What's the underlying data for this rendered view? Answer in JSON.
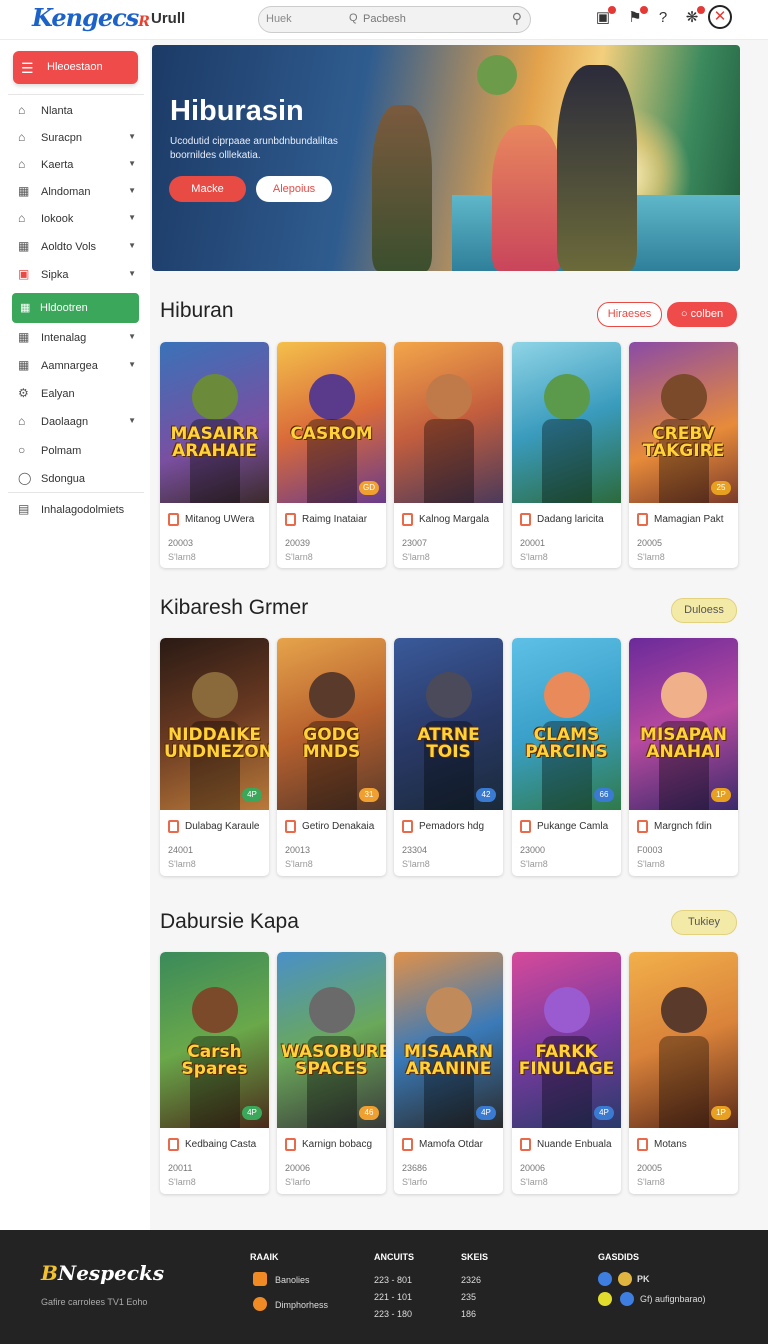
{
  "topbar": {
    "logo_main": "Kengecs",
    "logo_accent": "R",
    "user": "Urull",
    "search_placeholder": "Huek",
    "search_hint": "Pacbesh",
    "search_hint_icon": "Q"
  },
  "sidebar": {
    "primary_label": "Hleoestaon",
    "items": [
      {
        "label": "Nlanta",
        "icon": "home-icon",
        "chev": false
      },
      {
        "label": "Suracpn",
        "icon": "home-icon",
        "chev": true
      },
      {
        "label": "Kaerta",
        "icon": "home-icon",
        "chev": true
      },
      {
        "label": "Alndoman",
        "icon": "grid-icon",
        "chev": true
      },
      {
        "label": "Iokook",
        "icon": "home-icon",
        "chev": true
      },
      {
        "label": "Aoldto Vols",
        "icon": "grid-icon",
        "chev": true
      },
      {
        "label": "Sipka",
        "icon": "box-icon",
        "chev": true
      }
    ],
    "active_label": "Hldootren",
    "items2": [
      {
        "label": "Intenalag",
        "icon": "grid-icon",
        "chev": true
      },
      {
        "label": "Aamnargea",
        "icon": "grid-icon",
        "chev": true
      },
      {
        "label": "Ealyan",
        "icon": "gear-icon",
        "chev": false
      },
      {
        "label": "Daolaagn",
        "icon": "home-icon",
        "chev": true
      },
      {
        "label": "Polmam",
        "icon": "circle-icon",
        "chev": false
      },
      {
        "label": "Sdongua",
        "icon": "shield-icon",
        "chev": false
      }
    ],
    "bottom_label": "Inhalagodolmiets"
  },
  "hero": {
    "title": "Hiburasin",
    "desc": "Ucodutid ciprpaae arunbdnbundaliltas boornildes olllekatia.",
    "btn1": "Macke",
    "btn2": "Alepoius"
  },
  "sections": [
    {
      "title": "Hiburan",
      "pill1": "Hiraeses",
      "pill2": "colben",
      "pill2_icon": "○",
      "cards": [
        {
          "art": "MASAIRR ARAHAIE",
          "name": "Mitanog UWera",
          "num": "20003",
          "sub": "S'larn8",
          "badge": ""
        },
        {
          "art": "CASROM",
          "name": "Raimg Inataiar",
          "num": "20039",
          "sub": "S'larn8",
          "badge": "GD"
        },
        {
          "art": "",
          "name": "Kalnog Margala",
          "num": "23007",
          "sub": "S'larn8",
          "badge": ""
        },
        {
          "art": "",
          "name": "Dadang laricita",
          "num": "20001",
          "sub": "S'larn8",
          "badge": ""
        },
        {
          "art": "CREBV TAKGIRE",
          "name": "Mamagian Pakt",
          "num": "20005",
          "sub": "S'larn8",
          "badge": "25"
        }
      ]
    },
    {
      "title": "Kibaresh Grmer",
      "pill1": "Duloess",
      "cards": [
        {
          "art": "NIDDAIKE UNDNEZON",
          "name": "Dulabag Karaule",
          "num": "24001",
          "sub": "S'larn8",
          "badge": "4P"
        },
        {
          "art": "GODG MNDS",
          "name": "Getiro Denakaia",
          "num": "20013",
          "sub": "S'larn8",
          "badge": "31"
        },
        {
          "art": "ATRNE TOIS",
          "name": "Pemadors hdg",
          "num": "23304",
          "sub": "S'larn8",
          "badge": "42"
        },
        {
          "art": "CLAMS PARCINS",
          "name": "Pukange Camla",
          "num": "23000",
          "sub": "S'larn8",
          "badge": "66"
        },
        {
          "art": "MISAPAN ANAHAI",
          "name": "Margnch fdin",
          "num": "F0003",
          "sub": "S'larn8",
          "badge": "1P"
        }
      ]
    },
    {
      "title": "Dabursie Kapa",
      "pill1": "Tukiey",
      "cards": [
        {
          "art": "Carsh Spares",
          "name": "Kedbaing Casta",
          "num": "20011",
          "sub": "S'larn8",
          "badge": "4P"
        },
        {
          "art": "WASOBURE SPACES",
          "name": "Karnign bobacg",
          "num": "20006",
          "sub": "S'larfo",
          "badge": "46"
        },
        {
          "art": "MISAARN ARANINE",
          "name": "Mamofa Otdar",
          "num": "23686",
          "sub": "S'larfo",
          "badge": "4P"
        },
        {
          "art": "FARKK FINULAGE",
          "name": "Nuande Enbuala",
          "num": "20006",
          "sub": "S'larn8",
          "badge": "4P"
        },
        {
          "art": "",
          "name": "Motans",
          "num": "20005",
          "sub": "S'larn8",
          "badge": "1P"
        }
      ]
    }
  ],
  "footer": {
    "logo": "Nespecks",
    "logo_initial": "B",
    "tagline": "Gafire carrolees TV1 Eoho",
    "col1_head": "RAAIK",
    "col1_items": [
      "Banolies",
      "Dimphorhess"
    ],
    "col2_head": "ANCUITS",
    "col2_items": [
      "223 - 801",
      "221 - 101",
      "223 - 180"
    ],
    "col3_head": "SKEIS",
    "col3_items": [
      "2326",
      "235",
      "186"
    ],
    "col4_head": "GASDIDS",
    "col4_items": [
      "PK",
      "Gf) aufignbarao)"
    ]
  }
}
